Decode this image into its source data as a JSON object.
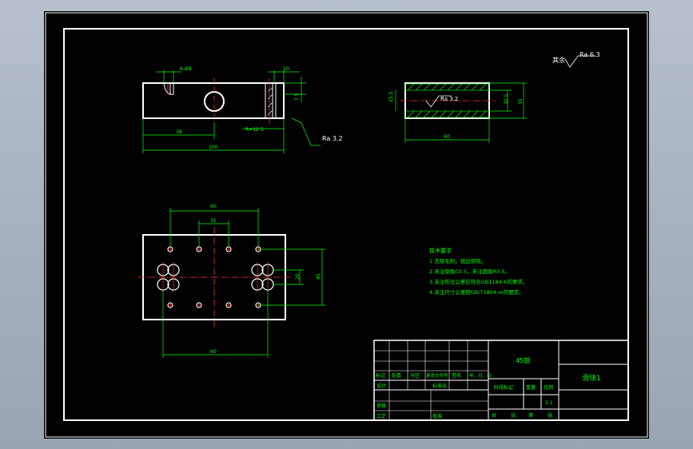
{
  "drawing": {
    "roughness_general": {
      "label": "其余",
      "value": "Ra 6.3"
    },
    "top_view": {
      "dim_top_left": "6-Ø8",
      "dim_top_right": "10",
      "dim_right_vertical": "7.5",
      "dim_middle": "38",
      "dim_chamfer_note": "R=12.5",
      "dim_overall": "100",
      "roughness": "Ra 3.2"
    },
    "section_view": {
      "roughness_inner": "Ra 3.2",
      "dim_left": "25.5",
      "dim_right_inner": "30.5",
      "dim_right_outer": "35",
      "dim_bottom": "60"
    },
    "plan_view": {
      "dim_top_outer": "60",
      "dim_top_inner": "31",
      "dim_right_inner": "20",
      "dim_right_outer": "40",
      "dim_bottom": "60"
    },
    "technical_requirements": {
      "heading": "技术要求",
      "items": [
        "1.去除毛刺，锐边倒钝。",
        "2.未注倒角C0.5，未注圆角R0.5。",
        "3.未注形位公差应符合GB1184-K的要求。",
        "4.未注尺寸公差按GB/T1804-m的要求。"
      ]
    },
    "title_block": {
      "material": "45钢",
      "part_name": "滑块1",
      "scale_value": "1:1",
      "headers_row": [
        "标记",
        "处数",
        "分区",
        "更改文件号",
        "签名",
        "年、月、日"
      ],
      "labels": {
        "design": "设计",
        "standardize": "标准化",
        "review": "审核",
        "craft": "工艺",
        "approve": "批准",
        "stage_mark": "阶段标记",
        "weight": "重量",
        "scale": "比例",
        "sheet_total": "共",
        "sheet_unit": "张",
        "sheet_no": "第",
        "sheet_unit2": "张"
      }
    }
  }
}
